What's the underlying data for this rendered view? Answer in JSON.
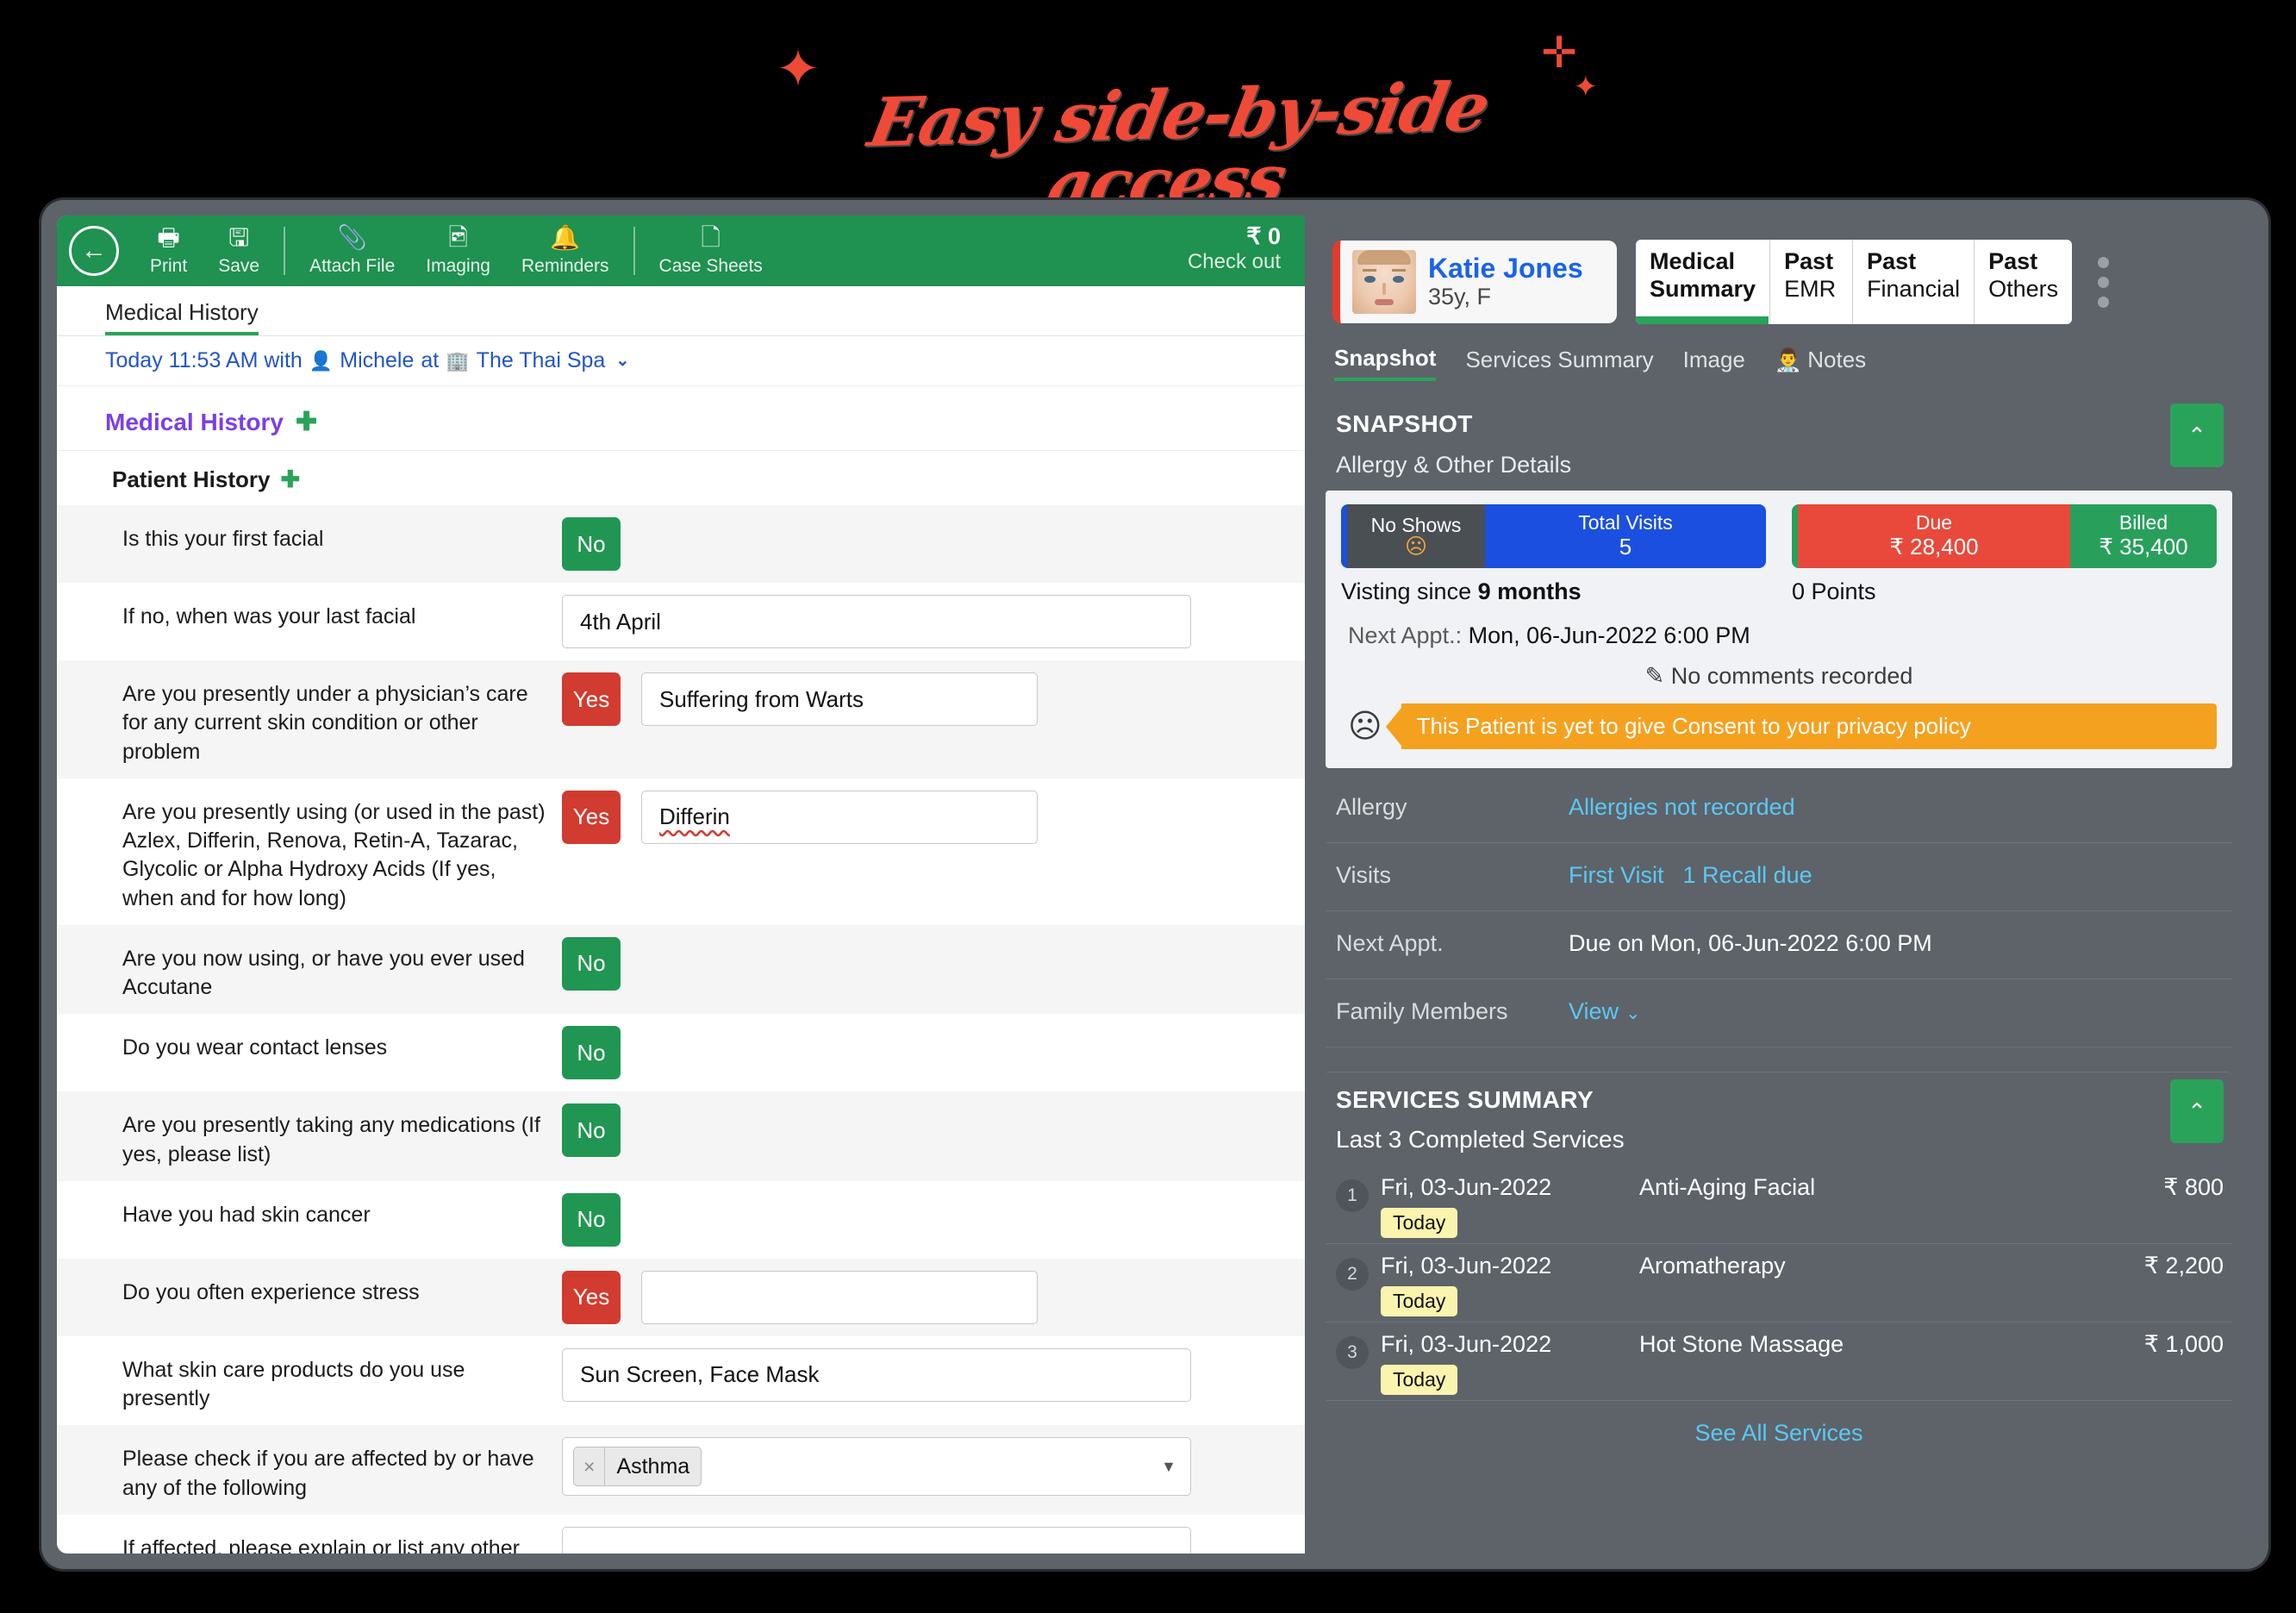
{
  "headline": {
    "text": "Easy side-by-side access",
    "color": "#ef4a37",
    "sparkle": "✦",
    "sparkle2": "✛"
  },
  "toolbar": {
    "back_icon": "←",
    "items": [
      {
        "icon": "🖶",
        "label": "Print",
        "name": "print"
      },
      {
        "icon": "🖫",
        "label": "Save",
        "name": "save"
      },
      {
        "icon": "📎",
        "label": "Attach File",
        "name": "attach-file"
      },
      {
        "icon": "🖻",
        "label": "Imaging",
        "name": "imaging"
      },
      {
        "icon": "🔔",
        "label": "Reminders",
        "name": "reminders"
      },
      {
        "icon": "🗋",
        "label": "Case Sheets",
        "name": "case-sheets"
      }
    ],
    "amount": "₹ 0",
    "checkout_label": "Check out"
  },
  "left": {
    "tab_label": "Medical History",
    "visit_line": {
      "prefix": "Today 11:53 AM with",
      "provider_icon": "👤",
      "provider": "Michele",
      "at": "at",
      "clinic_icon": "🏢",
      "clinic": "The Thai Spa",
      "caret": "⌄"
    },
    "section_title": "Medical History",
    "section_plus": "✚",
    "subsection_title": "Patient History",
    "subsection_plus": "✚",
    "questions": [
      {
        "label": "Is this your first facial",
        "answer": "No",
        "answer_type": "no",
        "field": null,
        "field_type": null
      },
      {
        "label": "If no, when was your last facial",
        "answer": null,
        "answer_type": null,
        "field": "4th April",
        "field_type": "wide"
      },
      {
        "label": "Are you presently under a physician’s care for any current skin condition or other problem",
        "answer": "Yes",
        "answer_type": "yes",
        "field": "Suffering from Warts",
        "field_type": "mid"
      },
      {
        "label": "Are you presently using (or used in the past) Azlex, Differin, Renova, Retin-A, Tazarac, Glycolic or Alpha Hydroxy Acids (If yes, when and for how long)",
        "answer": "Yes",
        "answer_type": "yes",
        "field": "Differin",
        "field_type": "mid-spell"
      },
      {
        "label": "Are you now using, or have you ever used Accutane",
        "answer": "No",
        "answer_type": "no",
        "field": null,
        "field_type": null
      },
      {
        "label": "Do you wear contact lenses",
        "answer": "No",
        "answer_type": "no",
        "field": null,
        "field_type": null
      },
      {
        "label": "Are you presently taking any medications (If yes, please list)",
        "answer": "No",
        "answer_type": "no",
        "field": null,
        "field_type": null
      },
      {
        "label": "Have you had skin cancer",
        "answer": "No",
        "answer_type": "no",
        "field": null,
        "field_type": null
      },
      {
        "label": "Do you often experience stress",
        "answer": "Yes",
        "answer_type": "yes",
        "field": "",
        "field_type": "mid"
      },
      {
        "label": "What skin care products do you use presently",
        "answer": null,
        "answer_type": null,
        "field": "Sun Screen, Face Mask",
        "field_type": "wide"
      },
      {
        "label": "Please check if you are affected by or have any of the following",
        "answer": null,
        "answer_type": null,
        "field": "Asthma",
        "field_type": "select"
      },
      {
        "label": "If affected, please explain or list any other significant issues we should know about",
        "answer": null,
        "answer_type": null,
        "field": "",
        "field_type": "textarea"
      }
    ],
    "chip_remove_icon": "×",
    "select_caret": "▼"
  },
  "right": {
    "patient": {
      "name": "Katie Jones",
      "meta": "35y, F"
    },
    "patient_tabs": [
      {
        "line1": "Medical",
        "line2": "Summary",
        "active": true
      },
      {
        "line1": "Past",
        "line2": "EMR",
        "active": false
      },
      {
        "line1": "Past",
        "line2": "Financial",
        "active": false
      },
      {
        "line1": "Past",
        "line2": "Others",
        "active": false
      }
    ],
    "sub_tabs": [
      {
        "label": "Snapshot",
        "icon": "",
        "active": true
      },
      {
        "label": "Services Summary",
        "icon": "",
        "active": false
      },
      {
        "label": "Image",
        "icon": "",
        "active": false
      },
      {
        "label": "Notes",
        "icon": "👨‍⚕",
        "active": false
      }
    ],
    "snapshot": {
      "title": "SNAPSHOT",
      "collapse_icon": "⌃",
      "subtitle": "Allergy & Other Details",
      "stats": {
        "no_shows_label": "No Shows",
        "no_shows_face": "☹",
        "total_visits_label": "Total Visits",
        "total_visits_value": "5",
        "due_label": "Due",
        "due_value": "₹ 28,400",
        "billed_label": "Billed",
        "billed_value": "₹ 35,400"
      },
      "visiting_since_prefix": "Visting since ",
      "visiting_since_value": "9 months",
      "points": "0 Points",
      "next_appt_key": "Next Appt.:",
      "next_appt_value": "Mon, 06-Jun-2022 6:00 PM",
      "no_comments_icon": "✎",
      "no_comments": "No comments recorded",
      "consent_face": "☹",
      "consent_text": "This Patient is yet to give Consent to your privacy policy",
      "rows": [
        {
          "key": "Allergy",
          "value": "Allergies not recorded",
          "link": true,
          "value2": null,
          "caret": null
        },
        {
          "key": "Visits",
          "value": "First Visit",
          "link": true,
          "value2": "1 Recall due",
          "caret": null
        },
        {
          "key": "Next Appt.",
          "value": "Due on Mon, 06-Jun-2022 6:00 PM",
          "link": false,
          "value2": null,
          "caret": null
        },
        {
          "key": "Family Members",
          "value": "View",
          "link": true,
          "value2": null,
          "caret": "⌄"
        }
      ]
    },
    "services": {
      "title": "SERVICES SUMMARY",
      "collapse_icon": "⌃",
      "subtitle": "Last 3 Completed Services",
      "badge_today": "Today",
      "rows": [
        {
          "num": "1",
          "date": "Fri, 03-Jun-2022",
          "name": "Anti-Aging Facial",
          "amount": "₹ 800"
        },
        {
          "num": "2",
          "date": "Fri, 03-Jun-2022",
          "name": "Aromatherapy",
          "amount": "₹ 2,200"
        },
        {
          "num": "3",
          "date": "Fri, 03-Jun-2022",
          "name": "Hot Stone Massage",
          "amount": "₹ 1,000"
        }
      ],
      "see_all": "See All Services"
    },
    "kebab_icon": "⋮"
  },
  "colors": {
    "toolbar_green": "#1f9150",
    "accent_green": "#2aa35a",
    "yes_red": "#d23b2f",
    "no_green": "#219653",
    "due_red": "#e8493a",
    "visits_blue": "#1a4fe0",
    "link_blue": "#5bc8f5",
    "consent_orange": "#f4a120",
    "panel_gray": "#5d6369",
    "headline_red": "#ef4a37"
  }
}
